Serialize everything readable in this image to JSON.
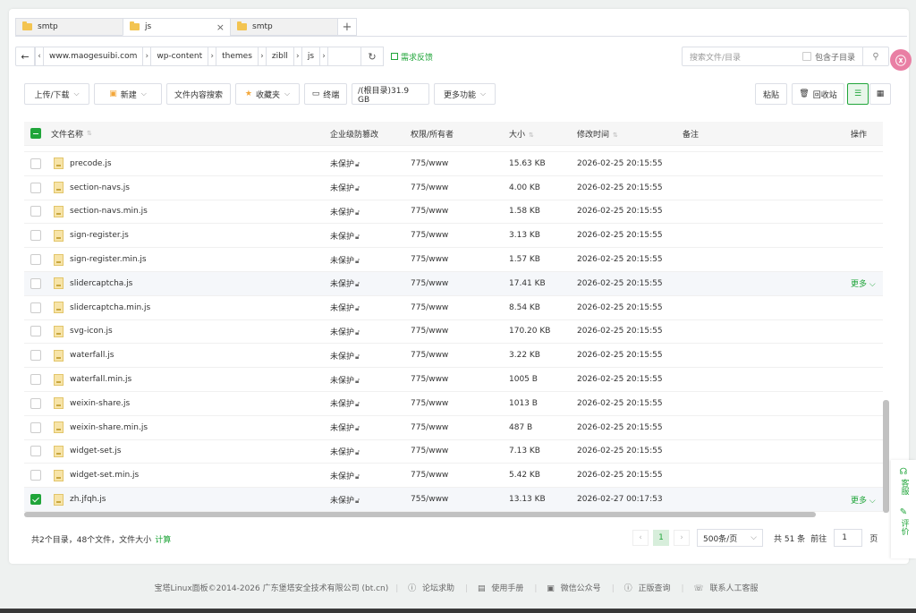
{
  "tabs": [
    {
      "label": "smtp",
      "active": false
    },
    {
      "label": "js",
      "active": true
    },
    {
      "label": "smtp",
      "active": false
    }
  ],
  "path": {
    "crumbs": [
      "www.maogesuibi.com",
      "wp-content",
      "themes",
      "zibll",
      "js"
    ],
    "feedback": "需求反馈"
  },
  "search": {
    "placeholder": "搜索文件/目录",
    "subdir_label": "包含子目录"
  },
  "toolbar": {
    "upload": "上传/下载",
    "new": "新建",
    "content_search": "文件内容搜索",
    "favorites": "收藏夹",
    "terminal": "终端",
    "disk": "/(根目录)31.9 GB",
    "more": "更多功能",
    "paste": "粘贴",
    "recycle": "回收站"
  },
  "table": {
    "headers": {
      "name": "文件名称",
      "protect": "企业级防篡改",
      "perm": "权限/所有者",
      "size": "大小",
      "time": "修改时间",
      "note": "备注",
      "op": "操作"
    },
    "rows": [
      {
        "name": "precode.js",
        "protect": "未保护",
        "perm": "775/www",
        "size": "15.63 KB",
        "time": "2026-02-25 20:15:55",
        "op": ""
      },
      {
        "name": "section-navs.js",
        "protect": "未保护",
        "perm": "775/www",
        "size": "4.00 KB",
        "time": "2026-02-25 20:15:55",
        "op": ""
      },
      {
        "name": "section-navs.min.js",
        "protect": "未保护",
        "perm": "775/www",
        "size": "1.58 KB",
        "time": "2026-02-25 20:15:55",
        "op": ""
      },
      {
        "name": "sign-register.js",
        "protect": "未保护",
        "perm": "775/www",
        "size": "3.13 KB",
        "time": "2026-02-25 20:15:55",
        "op": ""
      },
      {
        "name": "sign-register.min.js",
        "protect": "未保护",
        "perm": "775/www",
        "size": "1.57 KB",
        "time": "2026-02-25 20:15:55",
        "op": ""
      },
      {
        "name": "slidercaptcha.js",
        "protect": "未保护",
        "perm": "775/www",
        "size": "17.41 KB",
        "time": "2026-02-25 20:15:55",
        "op": "更多 ⌵"
      },
      {
        "name": "slidercaptcha.min.js",
        "protect": "未保护",
        "perm": "775/www",
        "size": "8.54 KB",
        "time": "2026-02-25 20:15:55",
        "op": ""
      },
      {
        "name": "svg-icon.js",
        "protect": "未保护",
        "perm": "775/www",
        "size": "170.20 KB",
        "time": "2026-02-25 20:15:55",
        "op": ""
      },
      {
        "name": "waterfall.js",
        "protect": "未保护",
        "perm": "775/www",
        "size": "3.22 KB",
        "time": "2026-02-25 20:15:55",
        "op": ""
      },
      {
        "name": "waterfall.min.js",
        "protect": "未保护",
        "perm": "775/www",
        "size": "1005 B",
        "time": "2026-02-25 20:15:55",
        "op": ""
      },
      {
        "name": "weixin-share.js",
        "protect": "未保护",
        "perm": "775/www",
        "size": "1013 B",
        "time": "2026-02-25 20:15:55",
        "op": ""
      },
      {
        "name": "weixin-share.min.js",
        "protect": "未保护",
        "perm": "775/www",
        "size": "487 B",
        "time": "2026-02-25 20:15:55",
        "op": ""
      },
      {
        "name": "widget-set.js",
        "protect": "未保护",
        "perm": "775/www",
        "size": "7.13 KB",
        "time": "2026-02-25 20:15:55",
        "op": ""
      },
      {
        "name": "widget-set.min.js",
        "protect": "未保护",
        "perm": "775/www",
        "size": "5.42 KB",
        "time": "2026-02-25 20:15:55",
        "op": ""
      },
      {
        "name": "zh.jfqh.js",
        "protect": "未保护",
        "perm": "755/www",
        "size": "13.13 KB",
        "time": "2026-02-27 00:17:53",
        "op": "更多 ⌵"
      }
    ]
  },
  "summary": {
    "text": "共2个目录，48个文件，文件大小",
    "calc": "计算"
  },
  "pager": {
    "page": "1",
    "per_page": "500条/页",
    "total": "共 51 条",
    "goto": "前往",
    "goto_value": "1",
    "page_unit": "页"
  },
  "side": {
    "service": "客服",
    "rate": "评价"
  },
  "copyright": {
    "text": "宝塔Linux面板©2014-2026 广东堡塔安全技术有限公司 (bt.cn)",
    "links": [
      "论坛求助",
      "使用手册",
      "微信公众号",
      "正版查询",
      "联系人工客服"
    ]
  }
}
